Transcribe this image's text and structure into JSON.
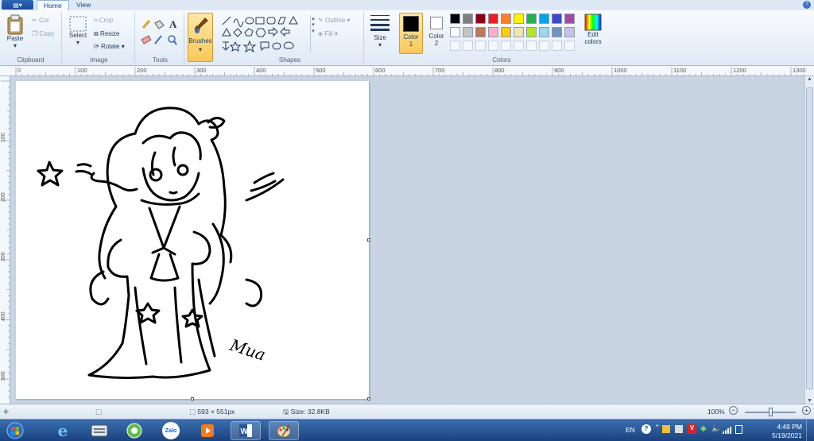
{
  "window": {
    "file_button": "▤▾",
    "help": "?"
  },
  "tabs": [
    {
      "label": "Home",
      "active": true
    },
    {
      "label": "View",
      "active": false
    }
  ],
  "ribbon": {
    "clipboard": {
      "label": "Clipboard",
      "paste": "Paste",
      "cut": "Cut",
      "copy": "Copy"
    },
    "image": {
      "label": "Image",
      "select": "Select",
      "crop": "Crop",
      "resize": "Resize",
      "rotate": "Rotate"
    },
    "tools": {
      "label": "Tools"
    },
    "brushes": {
      "label": "Brushes"
    },
    "shapes": {
      "label": "Shapes",
      "outline": "Outline",
      "fill": "Fill"
    },
    "size": {
      "label": "Size"
    },
    "color1": {
      "label": "Color",
      "num": "1",
      "value": "#000000"
    },
    "color2": {
      "label": "Color",
      "num": "2",
      "value": "#ffffff"
    },
    "colors": {
      "label": "Colors",
      "edit_line1": "Edit",
      "edit_line2": "colors",
      "row1": [
        "#000000",
        "#7f7f7f",
        "#880015",
        "#ed1c24",
        "#ff7f27",
        "#fff200",
        "#22b14c",
        "#00a2e8",
        "#3f48cc",
        "#a349a4"
      ],
      "row2": [
        "#ffffff",
        "#c3c3c3",
        "#b97a57",
        "#ffaec9",
        "#ffc90e",
        "#efe4b0",
        "#b5e61d",
        "#99d9ea",
        "#7092be",
        "#c8bfe7"
      ]
    }
  },
  "ruler": {
    "h": [
      "0",
      "100",
      "200",
      "300",
      "400",
      "500",
      "600",
      "700",
      "800",
      "900",
      "1000",
      "1100",
      "1200",
      "1300"
    ],
    "v": [
      "100",
      "200",
      "300",
      "400",
      "500"
    ]
  },
  "status": {
    "dimensions": "593 × 551px",
    "size": "Size: 32.8KB",
    "zoom": "100%",
    "zoom_level_pct": 50
  },
  "drawing": {
    "signature": "Mua"
  },
  "taskbar": {
    "apps": [
      "start-orb",
      "internet-explorer",
      "explorer-app",
      "coc-coc-browser",
      "zalo",
      "media-player",
      "word",
      "paint"
    ],
    "zalo_label": "Zalo",
    "lang": "EN",
    "time": "4:49 PM",
    "date": "5/19/2021"
  }
}
